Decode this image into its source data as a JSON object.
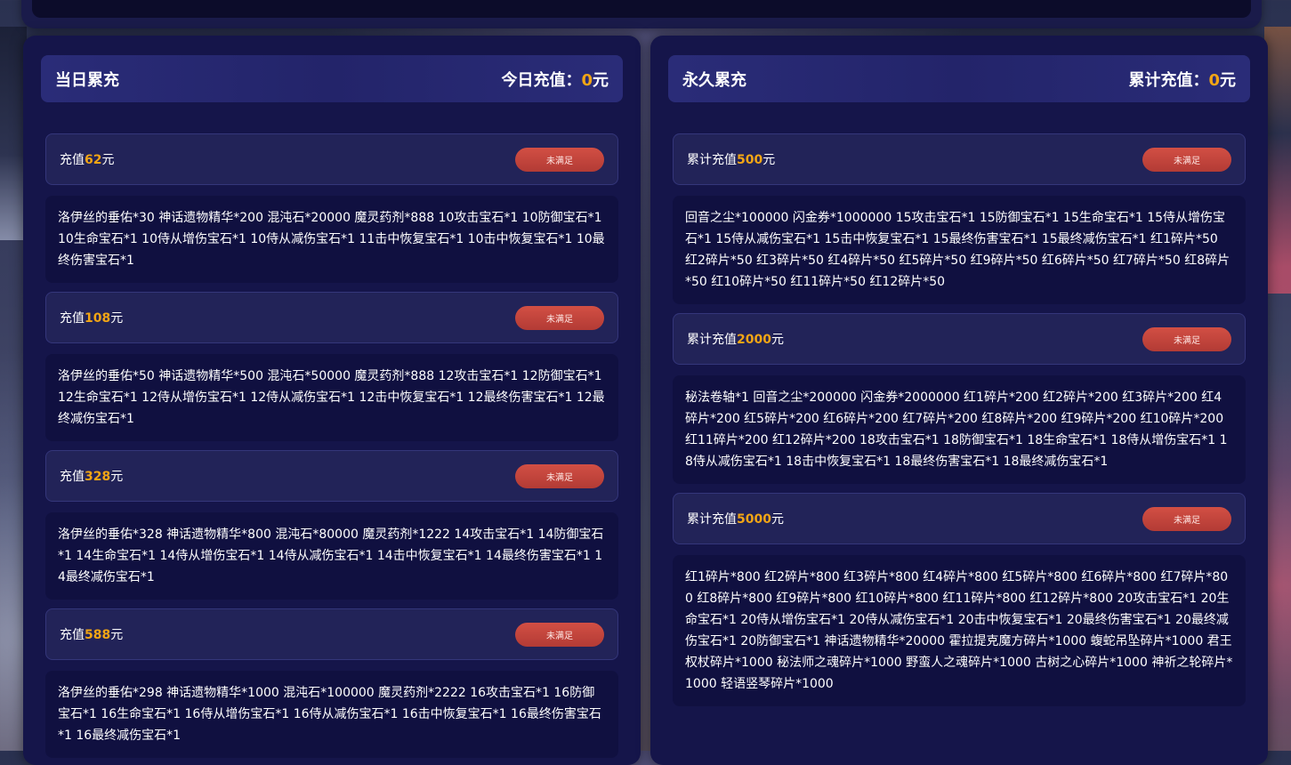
{
  "daily": {
    "title": "当日累充",
    "total_label": "今日充值：",
    "total_amount": "0",
    "total_unit": "元",
    "tiers": [
      {
        "prefix": "充值",
        "amount": "62",
        "unit": "元",
        "status": "未满足",
        "rewards": "洛伊丝的垂佑*30 神话遗物精华*200 混沌石*20000 魔灵药剂*888 10攻击宝石*1 10防御宝石*1 10生命宝石*1 10侍从增伤宝石*1 10侍从减伤宝石*1 11击中恢复宝石*1 10击中恢复宝石*1 10最终伤害宝石*1"
      },
      {
        "prefix": "充值",
        "amount": "108",
        "unit": "元",
        "status": "未满足",
        "rewards": "洛伊丝的垂佑*50 神话遗物精华*500 混沌石*50000 魔灵药剂*888 12攻击宝石*1 12防御宝石*1 12生命宝石*1 12侍从增伤宝石*1 12侍从减伤宝石*1 12击中恢复宝石*1 12最终伤害宝石*1 12最终减伤宝石*1"
      },
      {
        "prefix": "充值",
        "amount": "328",
        "unit": "元",
        "status": "未满足",
        "rewards": "洛伊丝的垂佑*328 神话遗物精华*800 混沌石*80000 魔灵药剂*1222 14攻击宝石*1 14防御宝石*1 14生命宝石*1 14侍从增伤宝石*1 14侍从减伤宝石*1 14击中恢复宝石*1 14最终伤害宝石*1 14最终减伤宝石*1"
      },
      {
        "prefix": "充值",
        "amount": "588",
        "unit": "元",
        "status": "未满足",
        "rewards": "洛伊丝的垂佑*298 神话遗物精华*1000 混沌石*100000 魔灵药剂*2222 16攻击宝石*1 16防御宝石*1 16生命宝石*1 16侍从增伤宝石*1 16侍从减伤宝石*1 16击中恢复宝石*1 16最终伤害宝石*1 16最终减伤宝石*1"
      }
    ]
  },
  "permanent": {
    "title": "永久累充",
    "total_label": "累计充值：",
    "total_amount": "0",
    "total_unit": "元",
    "tiers": [
      {
        "prefix": "累计充值",
        "amount": "500",
        "unit": "元",
        "status": "未满足",
        "rewards": "回音之尘*100000 闪金券*1000000 15攻击宝石*1 15防御宝石*1 15生命宝石*1 15侍从增伤宝石*1 15侍从减伤宝石*1 15击中恢复宝石*1 15最终伤害宝石*1 15最终减伤宝石*1 红1碎片*50 红2碎片*50 红3碎片*50 红4碎片*50 红5碎片*50 红9碎片*50 红6碎片*50 红7碎片*50 红8碎片*50 红10碎片*50 红11碎片*50 红12碎片*50"
      },
      {
        "prefix": "累计充值",
        "amount": "2000",
        "unit": "元",
        "status": "未满足",
        "rewards": "秘法卷轴*1 回音之尘*200000 闪金券*2000000 红1碎片*200 红2碎片*200 红3碎片*200 红4碎片*200 红5碎片*200 红6碎片*200 红7碎片*200 红8碎片*200 红9碎片*200 红10碎片*200 红11碎片*200 红12碎片*200 18攻击宝石*1 18防御宝石*1 18生命宝石*1 18侍从增伤宝石*1 18侍从减伤宝石*1 18击中恢复宝石*1 18最终伤害宝石*1 18最终减伤宝石*1"
      },
      {
        "prefix": "累计充值",
        "amount": "5000",
        "unit": "元",
        "status": "未满足",
        "rewards": "红1碎片*800 红2碎片*800 红3碎片*800 红4碎片*800 红5碎片*800 红6碎片*800 红7碎片*800 红8碎片*800 红9碎片*800 红10碎片*800 红11碎片*800 红12碎片*800 20攻击宝石*1 20生命宝石*1 20侍从增伤宝石*1 20侍从减伤宝石*1 20击中恢复宝石*1 20最终伤害宝石*1 20最终减伤宝石*1 20防御宝石*1 神话遗物精华*20000 霍拉提克魔方碎片*1000 蝮蛇吊坠碎片*1000 君王权杖碎片*1000 秘法师之魂碎片*1000 野蛮人之魂碎片*1000 古树之心碎片*1000 神祈之轮碎片*1000 轻语竖琴碎片*1000"
      }
    ]
  }
}
